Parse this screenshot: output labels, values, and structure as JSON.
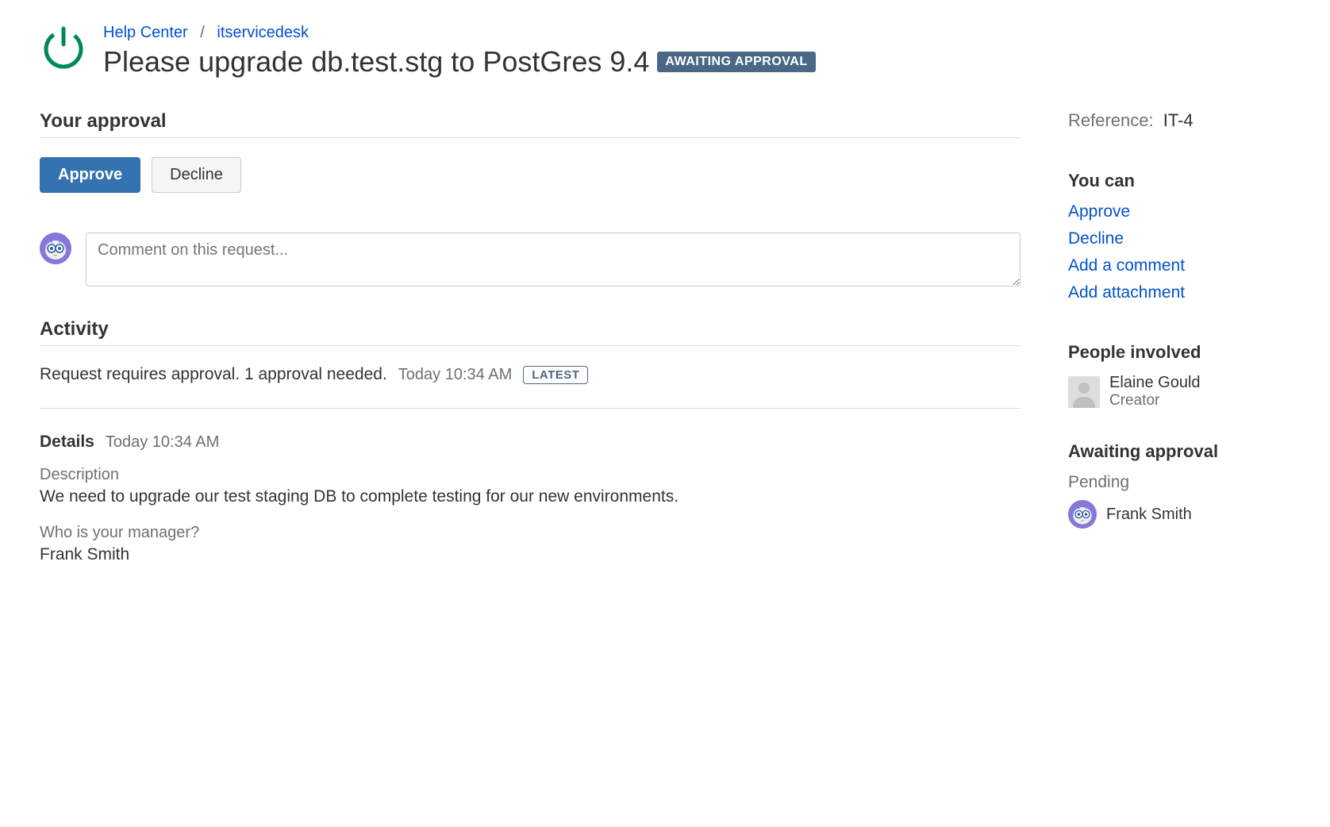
{
  "breadcrumb": {
    "help_center": "Help Center",
    "project": "itservicedesk"
  },
  "title": "Please upgrade db.test.stg to PostGres 9.4",
  "status_badge": "AWAITING APPROVAL",
  "approval": {
    "heading": "Your approval",
    "approve_label": "Approve",
    "decline_label": "Decline"
  },
  "comment": {
    "placeholder": "Comment on this request..."
  },
  "activity": {
    "heading": "Activity",
    "item_text": "Request requires approval. 1 approval needed.",
    "item_time": "Today 10:34 AM",
    "latest_badge": "LATEST"
  },
  "details": {
    "heading": "Details",
    "time": "Today 10:34 AM",
    "description_label": "Description",
    "description_value": "We need to upgrade our test staging DB to complete testing for our new environments.",
    "manager_label": "Who is your manager?",
    "manager_value": "Frank Smith"
  },
  "sidebar": {
    "reference_label": "Reference:",
    "reference_value": "IT-4",
    "you_can_heading": "You can",
    "links": {
      "approve": "Approve",
      "decline": "Decline",
      "add_comment": "Add a comment",
      "add_attachment": "Add attachment"
    },
    "people_heading": "People involved",
    "creator_name": "Elaine Gould",
    "creator_role": "Creator",
    "awaiting_heading": "Awaiting approval",
    "pending_label": "Pending",
    "approver_name": "Frank Smith"
  }
}
